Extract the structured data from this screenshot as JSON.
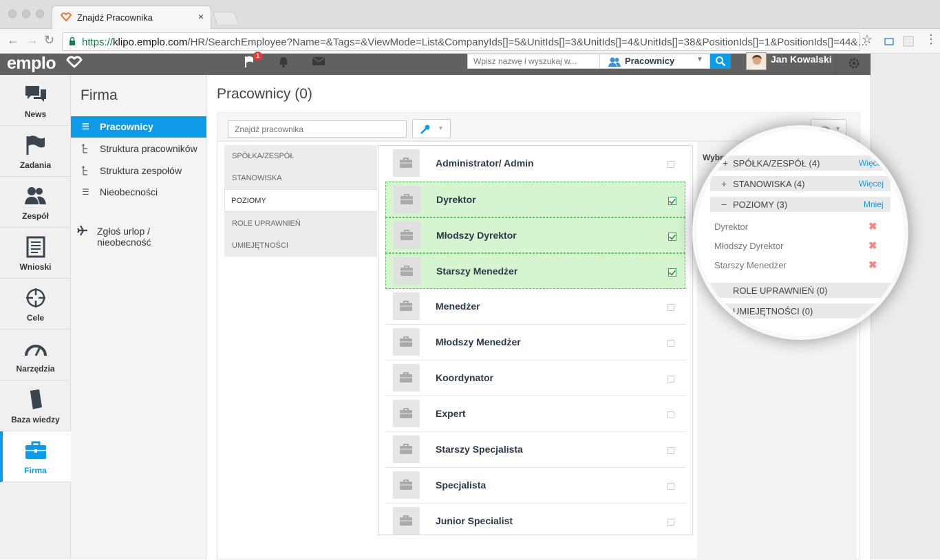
{
  "browser": {
    "tab_title": "Znajdź Pracownika",
    "tab_close": "×",
    "url_scheme": "https://",
    "url_host": "klipo.emplo.com",
    "url_path": "/HR/SearchEmployee?Name=&Tags=&ViewMode=List&CompanyIds[]=5&UnitIds[]=3&UnitIds[]=4&UnitIds[]=38&PositionIds[]=1&PositionIds[]=44&…"
  },
  "header": {
    "logo": "emplo",
    "search_placeholder": "Wpisz nazwę i wyszukaj w...",
    "scope": "Pracownicy",
    "user_name": "Jan Kowalski",
    "notification_count": "1"
  },
  "leftnav": {
    "items": [
      {
        "label": "News",
        "icon": "news-icon"
      },
      {
        "label": "Zadania",
        "icon": "flag-icon"
      },
      {
        "label": "Zespół",
        "icon": "team-icon"
      },
      {
        "label": "Wnioski",
        "icon": "document-icon"
      },
      {
        "label": "Cele",
        "icon": "target-icon"
      },
      {
        "label": "Narzędzia",
        "icon": "gauge-icon"
      },
      {
        "label": "Baza wiedzy",
        "icon": "book-icon"
      },
      {
        "label": "Firma",
        "icon": "briefcase-icon"
      }
    ]
  },
  "subnav": {
    "title": "Firma",
    "items": [
      {
        "label": "Pracownicy"
      },
      {
        "label": "Struktura pracowników"
      },
      {
        "label": "Struktura zespołów"
      },
      {
        "label": "Nieobecności"
      },
      {
        "label": "Zgłoś urlop / nieobecność"
      }
    ]
  },
  "main": {
    "title": "Pracownicy (0)",
    "find_placeholder": "Znajdź pracownika",
    "filter_categories": [
      "SPÓŁKA/ZESPÓŁ",
      "STANOWISKA",
      "POZIOMY",
      "ROLE UPRAWNIEŃ",
      "UMIEJĘTNOŚCI"
    ],
    "positions": [
      {
        "name": "Administrator/ Admin",
        "selected": false
      },
      {
        "name": "Dyrektor",
        "selected": true
      },
      {
        "name": "Młodszy Dyrektor",
        "selected": true
      },
      {
        "name": "Starszy Menedżer",
        "selected": true
      },
      {
        "name": "Menedżer",
        "selected": false
      },
      {
        "name": "Młodszy Menedżer",
        "selected": false
      },
      {
        "name": "Koordynator",
        "selected": false
      },
      {
        "name": "Expert",
        "selected": false
      },
      {
        "name": "Starszy Specjalista",
        "selected": false
      },
      {
        "name": "Specjalista",
        "selected": false
      },
      {
        "name": "Junior Specialist",
        "selected": false
      }
    ]
  },
  "selected_panel": {
    "title_fragment": "Wybran",
    "groups": [
      {
        "sign": "+",
        "label": "SPÓŁKA/ZESPÓŁ (4)",
        "action": "Więcej"
      },
      {
        "sign": "+",
        "label": "STANOWISKA (4)",
        "action": "Więcej"
      },
      {
        "sign": "−",
        "label": "POZIOMY (3)",
        "action": "Mniej"
      },
      {
        "sign": "",
        "label": "ROLE UPRAWNIEŃ (0)",
        "action": ""
      },
      {
        "sign": "",
        "label": "UMIEJĘTNOŚCI (0)",
        "action": ""
      }
    ],
    "items": [
      "Dyrektor",
      "Młodszy Dyrektor",
      "Starszy Menedżer"
    ],
    "remove_symbol": "✖"
  },
  "colors": {
    "accent": "#0d9ae6",
    "selected_bg": "#d5f5d0",
    "header_bg": "#616161"
  }
}
